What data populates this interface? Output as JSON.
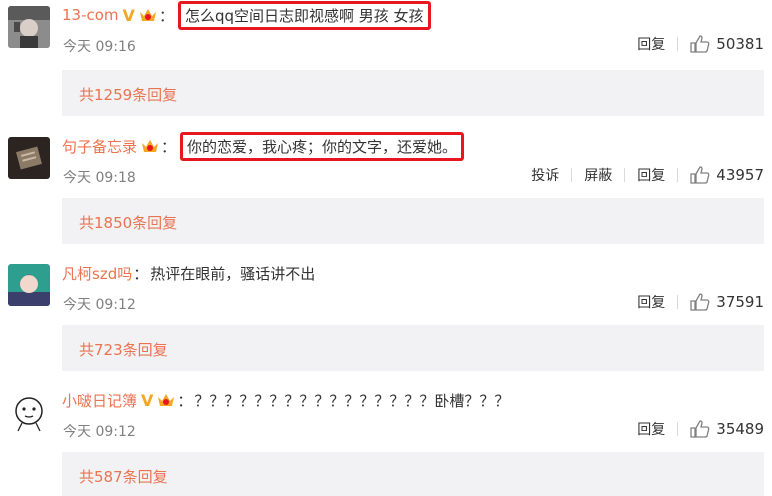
{
  "comments": [
    {
      "username": "13-com",
      "text": "怎么qq空间日志即视感啊  男孩 女孩",
      "time": "今天 09:16",
      "reply_label": "回复",
      "like_count": "50381",
      "replies_link": "共1259条回复",
      "has_v": true,
      "highlighted": true
    },
    {
      "username": "句子备忘录",
      "text": "你的恋爱，我心疼；你的文字，还爱她。",
      "time": "今天 09:18",
      "report_label": "投诉",
      "block_label": "屏蔽",
      "reply_label": "回复",
      "like_count": "43957",
      "replies_link": "共1850条回复",
      "has_v": false,
      "highlighted": true
    },
    {
      "username": "凡柯szd吗",
      "text": "热评在眼前，骚话讲不出",
      "time": "今天 09:12",
      "reply_label": "回复",
      "like_count": "37591",
      "replies_link": "共723条回复",
      "has_v": false,
      "highlighted": false
    },
    {
      "username": "小啵日记簿",
      "text": "？？？？？？？？？？？？？？？？卧槽？？？",
      "time": "今天 09:12",
      "reply_label": "回复",
      "like_count": "35489",
      "replies_link": "共587条回复",
      "has_v": true,
      "highlighted": false
    }
  ],
  "colon": "：",
  "v_badge": "V",
  "icons": {
    "like": "thumbs-up-icon",
    "member": "crown-icon",
    "verified": "v-badge-icon"
  },
  "colors": {
    "username": "#eb7350",
    "highlight_border": "#e8161e",
    "reply_box_bg": "#f2f2f5",
    "time": "#808080",
    "vip_orange": "#f5a623"
  }
}
